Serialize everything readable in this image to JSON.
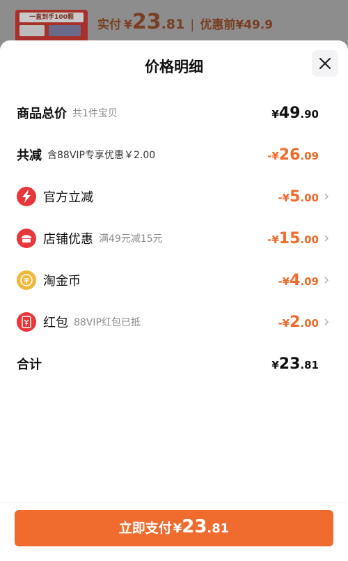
{
  "background": {
    "thumbnail_text": "一直到手100颗",
    "paid_label": "实付",
    "currency": "¥",
    "price_int": "23",
    "price_dec": ".81",
    "separator": "|",
    "pre_discount_label": "优惠前¥49.9"
  },
  "sheet": {
    "title": "价格明细",
    "close_icon": "close-icon"
  },
  "rows": {
    "total": {
      "label": "商品总价",
      "sub": "共1件宝贝",
      "currency": "¥",
      "int": "49",
      "dec": ".90"
    },
    "reduce": {
      "label": "共减",
      "sub": "含88VIP专享优惠￥2.00",
      "prefix": "-¥",
      "int": "26",
      "dec": ".09"
    },
    "official": {
      "icon": "lightning-icon",
      "label": "官方立减",
      "prefix": "-¥",
      "int": "5",
      "dec": ".00"
    },
    "store": {
      "icon": "store-icon",
      "label": "店铺优惠",
      "sub": "满49元减15元",
      "prefix": "-¥",
      "int": "15",
      "dec": ".00"
    },
    "coin": {
      "icon": "coin-icon",
      "label": "淘金币",
      "prefix": "-¥",
      "int": "4",
      "dec": ".09"
    },
    "redpacket": {
      "icon": "red-packet-icon",
      "label": "红包",
      "sub": "88VIP红包已抵",
      "prefix": "-¥",
      "int": "2",
      "dec": ".00"
    },
    "sum": {
      "label": "合计",
      "currency": "¥",
      "int": "23",
      "dec": ".81"
    }
  },
  "pay_button": {
    "label": "立即支付",
    "currency": "¥",
    "int": "23",
    "dec": ".81"
  },
  "colors": {
    "accent": "#ef6c2e",
    "discount": "#f06a2c",
    "icon_red": "#e8363a",
    "icon_gold": "#f3b73a"
  }
}
